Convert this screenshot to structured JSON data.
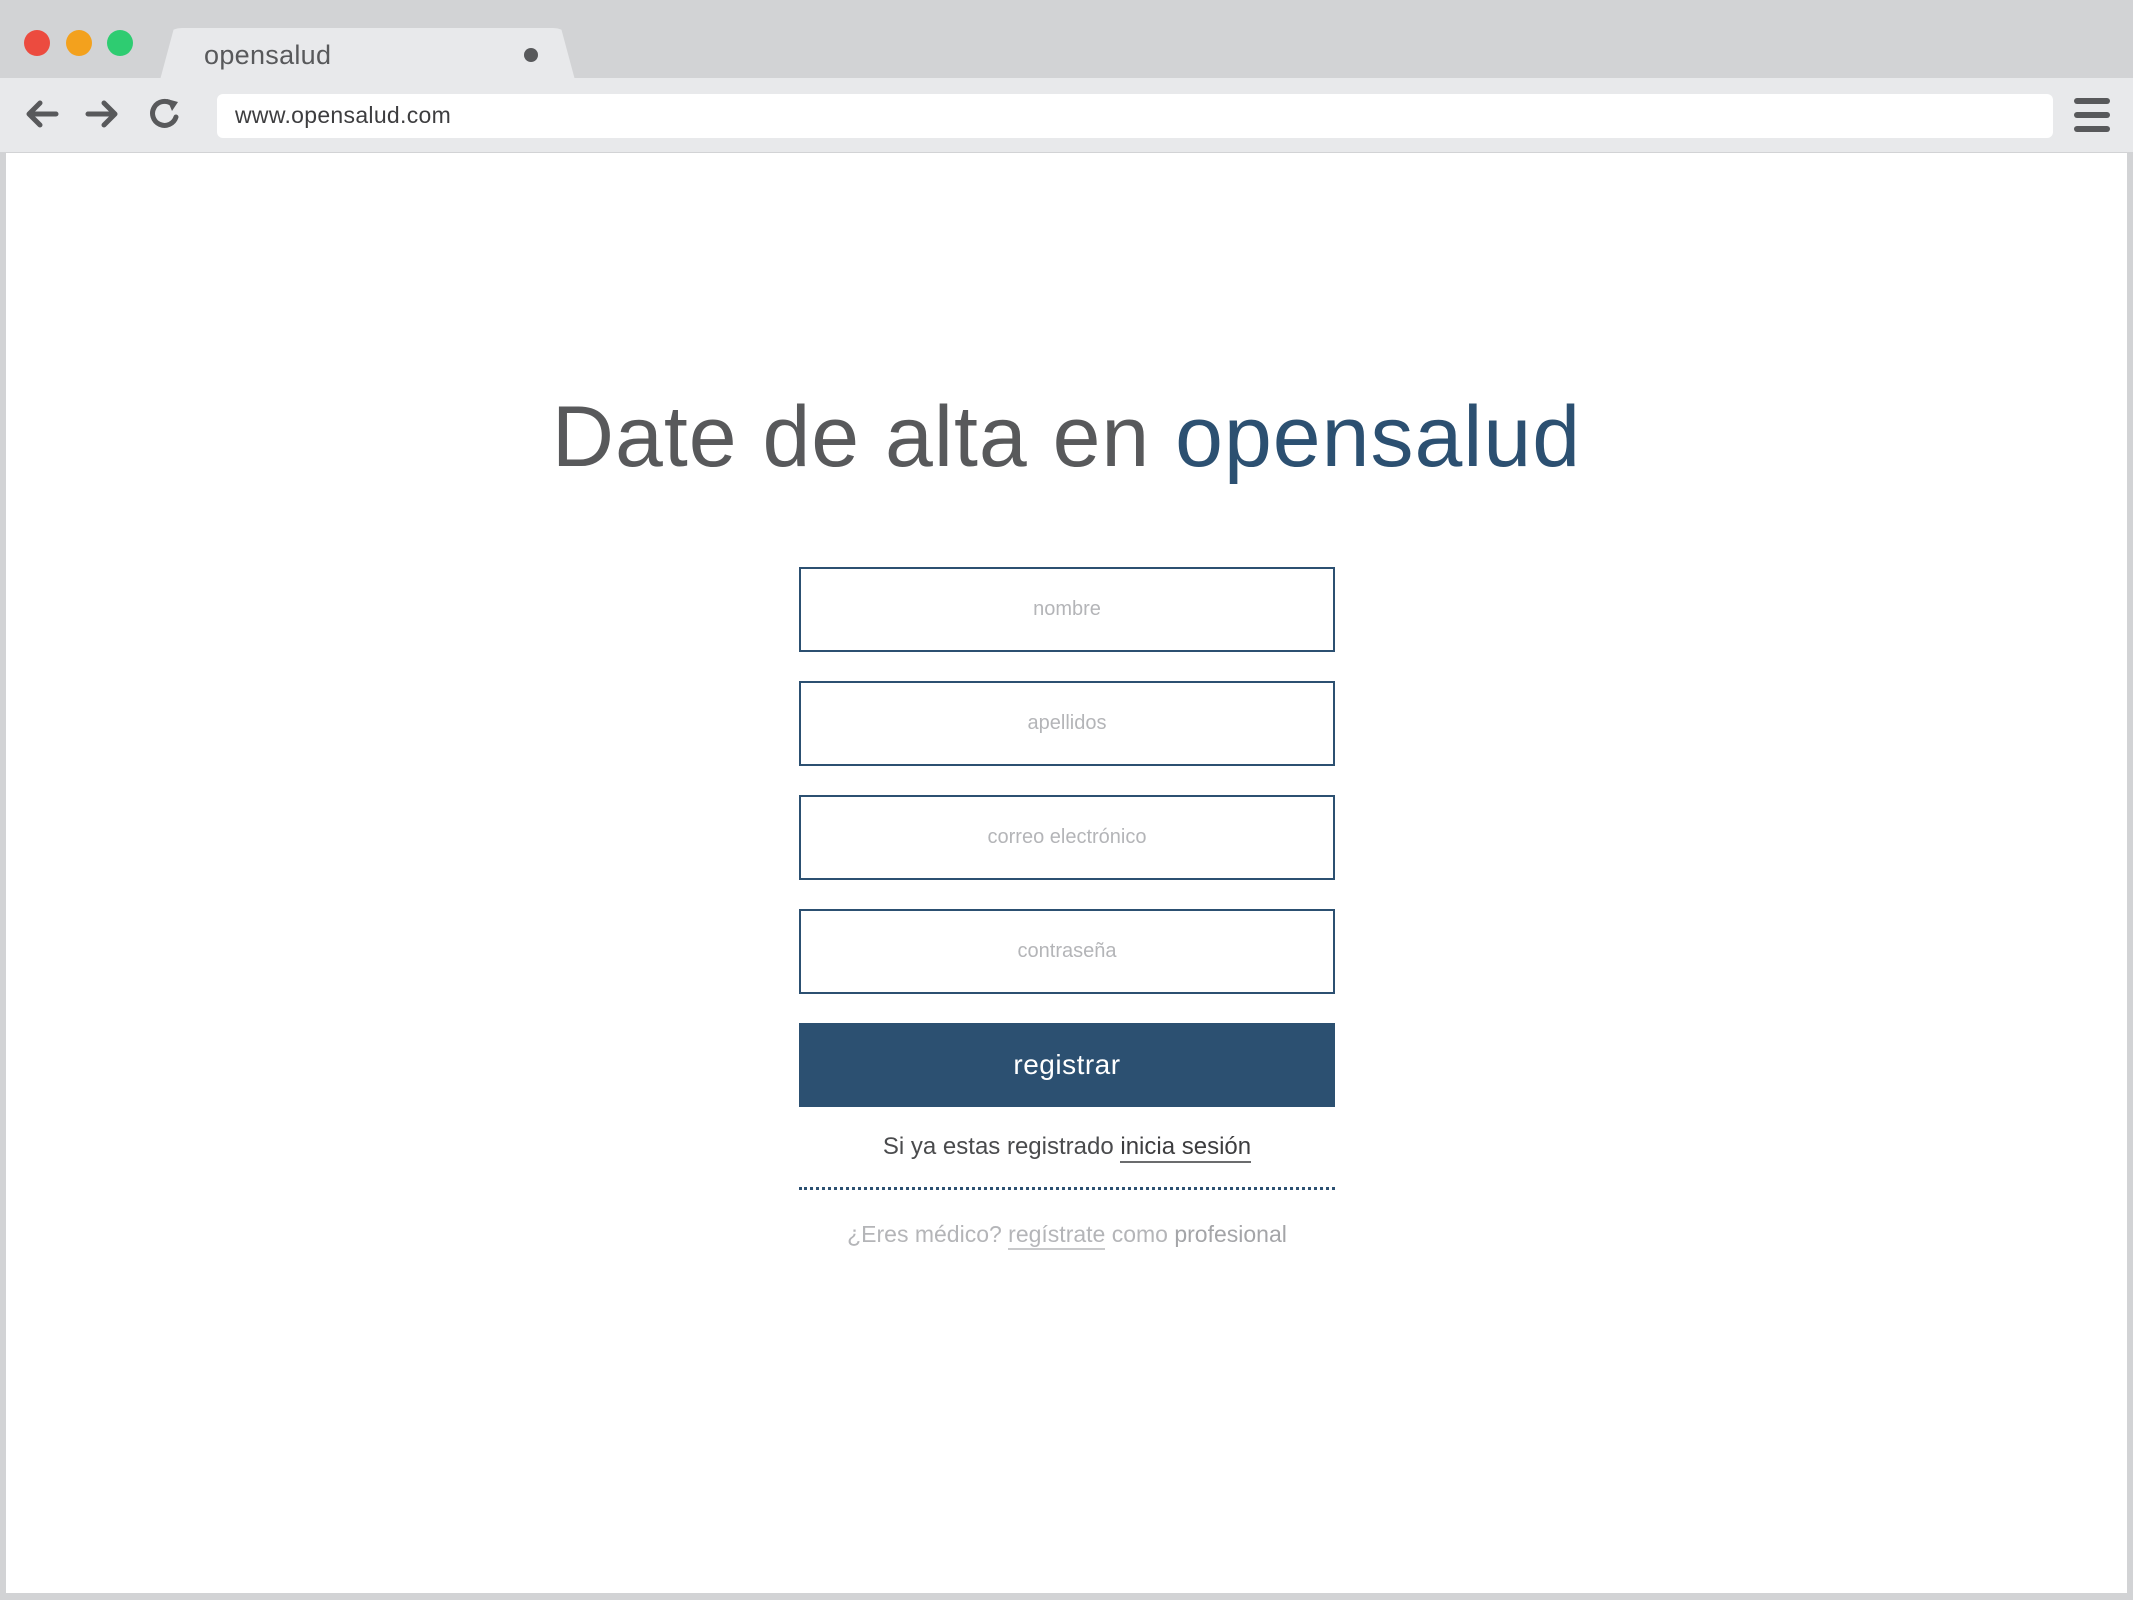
{
  "browser": {
    "tab_title": "opensalud",
    "url": "www.opensalud.com"
  },
  "page": {
    "headline_prefix": "Date de alta en ",
    "headline_brand": "opensalud",
    "fields": {
      "nombre_placeholder": "nombre",
      "apellidos_placeholder": "apellidos",
      "email_placeholder": "correo electrónico",
      "password_placeholder": "contraseña"
    },
    "submit_label": "registrar",
    "login_prompt": "Si ya estas registrado ",
    "login_link": "inicia sesión",
    "doctor_prompt": "¿Eres médico? ",
    "doctor_link": "regístrate",
    "doctor_mid": " como ",
    "doctor_suffix": "profesional"
  },
  "colors": {
    "brand": "#2c5071",
    "text": "#58595b",
    "muted": "#b4b5b8",
    "chrome": "#d2d3d5"
  },
  "icons": [
    "back-arrow-icon",
    "forward-arrow-icon",
    "reload-icon",
    "hamburger-menu-icon",
    "tab-dot-icon"
  ]
}
